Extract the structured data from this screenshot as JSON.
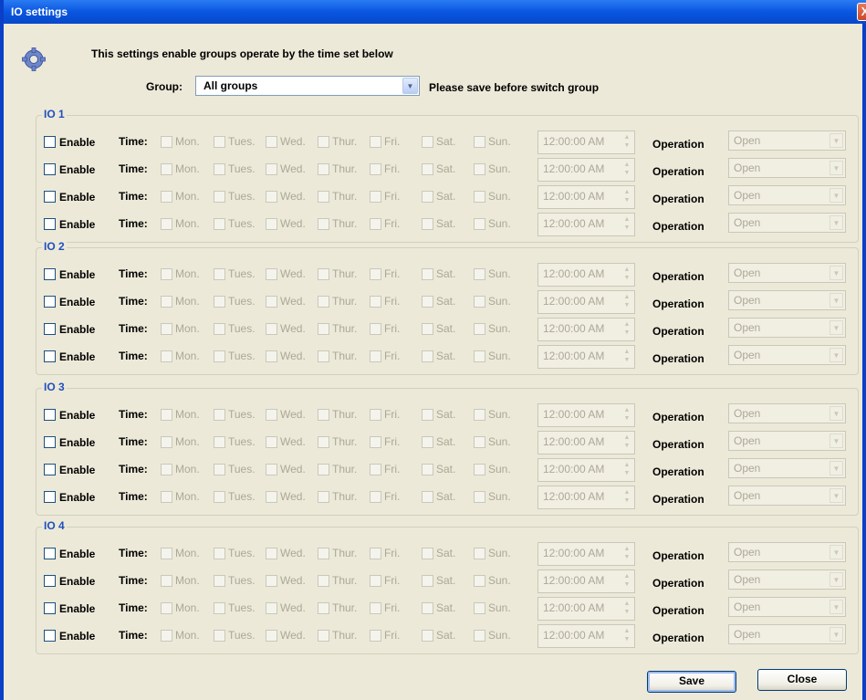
{
  "window": {
    "title": "IO settings",
    "close_glyph": "X"
  },
  "heading": "This settings enable groups  operate by the time set below",
  "group": {
    "label": "Group:",
    "value": "All groups",
    "note": "Please save before switch group"
  },
  "labels": {
    "enable": "Enable",
    "time": "Time:",
    "operation": "Operation",
    "days": [
      "Mon.",
      "Tues.",
      "Wed.",
      "Thur.",
      "Fri.",
      "Sat.",
      "Sun."
    ]
  },
  "sections": [
    {
      "title": "IO 1",
      "rows": [
        {
          "time": "12:00:00 AM",
          "operation": "Open"
        },
        {
          "time": "12:00:00 AM",
          "operation": "Open"
        },
        {
          "time": "12:00:00 AM",
          "operation": "Open"
        },
        {
          "time": "12:00:00 AM",
          "operation": "Open"
        }
      ]
    },
    {
      "title": "IO 2",
      "rows": [
        {
          "time": "12:00:00 AM",
          "operation": "Open"
        },
        {
          "time": "12:00:00 AM",
          "operation": "Open"
        },
        {
          "time": "12:00:00 AM",
          "operation": "Open"
        },
        {
          "time": "12:00:00 AM",
          "operation": "Open"
        }
      ]
    },
    {
      "title": "IO 3",
      "rows": [
        {
          "time": "12:00:00 AM",
          "operation": "Open"
        },
        {
          "time": "12:00:00 AM",
          "operation": "Open"
        },
        {
          "time": "12:00:00 AM",
          "operation": "Open"
        },
        {
          "time": "12:00:00 AM",
          "operation": "Open"
        }
      ]
    },
    {
      "title": "IO 4",
      "rows": [
        {
          "time": "12:00:00 AM",
          "operation": "Open"
        },
        {
          "time": "12:00:00 AM",
          "operation": "Open"
        },
        {
          "time": "12:00:00 AM",
          "operation": "Open"
        },
        {
          "time": "12:00:00 AM",
          "operation": "Open"
        }
      ]
    }
  ],
  "buttons": {
    "save": "Save",
    "close": "Close"
  },
  "colors": {
    "titlebar": "#0a56e0",
    "dialog_bg": "#ece9d8",
    "section_title": "#1f4fbf",
    "disabled_text": "#aca899"
  }
}
